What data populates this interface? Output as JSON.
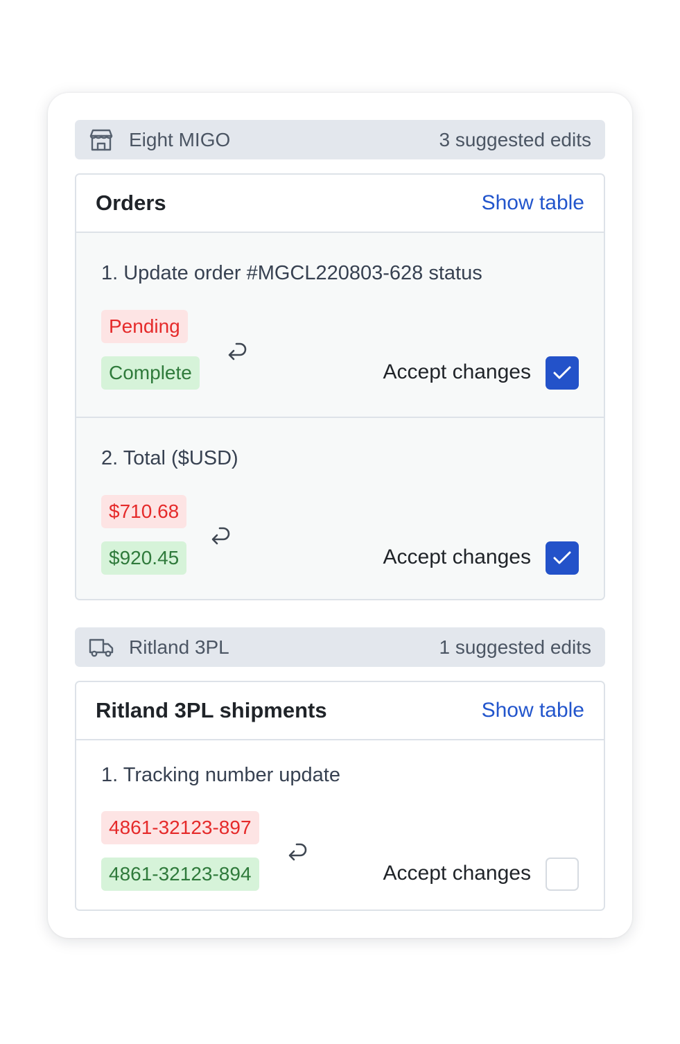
{
  "sources": [
    {
      "icon": "storefront-icon",
      "name": "Eight MIGO",
      "count_label": "3 suggested edits",
      "table": {
        "title": "Orders",
        "show_link": "Show table",
        "edits": [
          {
            "title": "1. Update order #MGCL220803-628 status",
            "old_value": "Pending",
            "new_value": "Complete",
            "accept_label": "Accept changes",
            "accepted": true
          },
          {
            "title": "2. Total ($USD)",
            "old_value": "$710.68",
            "new_value": "$920.45",
            "accept_label": "Accept changes",
            "accepted": true
          }
        ]
      }
    },
    {
      "icon": "truck-icon",
      "name": "Ritland 3PL",
      "count_label": "1 suggested edits",
      "table": {
        "title": "Ritland 3PL shipments",
        "show_link": "Show table",
        "edits": [
          {
            "title": "1. Tracking number update",
            "old_value": "4861-32123-897",
            "new_value": "4861-32123-894",
            "accept_label": "Accept changes",
            "accepted": false
          }
        ]
      }
    }
  ]
}
